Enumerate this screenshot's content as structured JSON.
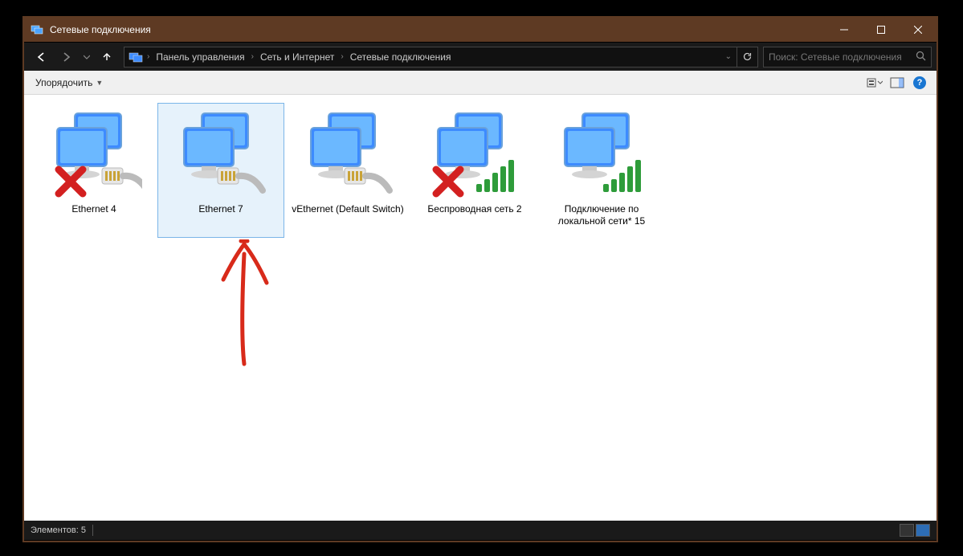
{
  "window": {
    "title": "Сетевые подключения"
  },
  "breadcrumb": {
    "root_icon": "control-panel",
    "items": [
      "Панель управления",
      "Сеть и Интернет",
      "Сетевые подключения"
    ]
  },
  "search": {
    "placeholder": "Поиск: Сетевые подключения"
  },
  "toolbar": {
    "organize": "Упорядочить"
  },
  "connections": [
    {
      "label": "Ethernet 4",
      "type": "ethernet",
      "status": "disconnected",
      "selected": false
    },
    {
      "label": "Ethernet 7",
      "type": "ethernet",
      "status": "connected",
      "selected": true
    },
    {
      "label": "vEthernet (Default Switch)",
      "type": "ethernet",
      "status": "connected",
      "selected": false
    },
    {
      "label": "Беспроводная сеть 2",
      "type": "wifi",
      "status": "disconnected",
      "selected": false
    },
    {
      "label": "Подключение по локальной сети* 15",
      "type": "wifi",
      "status": "connected",
      "selected": false
    }
  ],
  "statusbar": {
    "count_label": "Элементов: 5"
  }
}
